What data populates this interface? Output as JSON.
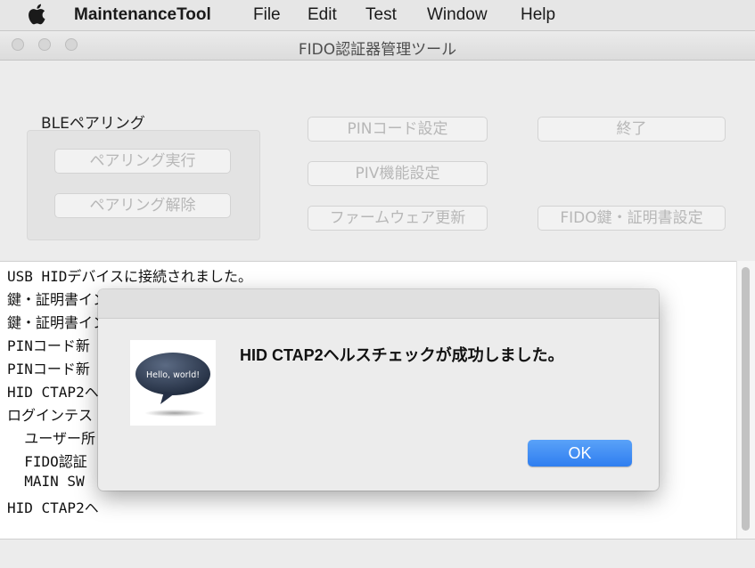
{
  "menubar": {
    "app_name": "MaintenanceTool",
    "items": [
      "File",
      "Edit",
      "Test",
      "Window",
      "Help"
    ]
  },
  "window": {
    "title": "FIDO認証器管理ツール"
  },
  "ble": {
    "label": "BLEペアリング",
    "pair_button": "ペアリング実行",
    "unpair_button": "ペアリング解除"
  },
  "buttons": {
    "pin_setting": "PINコード設定",
    "piv_setting": "PIV機能設定",
    "firmware_update": "ファームウェア更新",
    "quit": "終了",
    "fido_key_cert": "FIDO鍵・証明書設定"
  },
  "log": {
    "lines": [
      "USB HIDデバイスに接続されました。",
      "鍵・証明書インストールを開始します。",
      "鍵・証明書インストールが成功しました。",
      "PINコード新",
      "PINコード新",
      "HID CTAP2ヘ",
      "ログインテス",
      "  ユーザー所",
      "  FIDO認証",
      "  MAIN SW",
      "HID CTAP2ヘ"
    ]
  },
  "alert": {
    "message": "HID CTAP2ヘルスチェックが成功しました。",
    "icon_text": "Hello, world!",
    "ok_button": "OK"
  },
  "colors": {
    "accent": "#2f7ef0",
    "disabled_text": "#b7b7b7"
  },
  "icons": {
    "apple": "apple-logo-icon",
    "app": "speech-bubble-icon"
  }
}
